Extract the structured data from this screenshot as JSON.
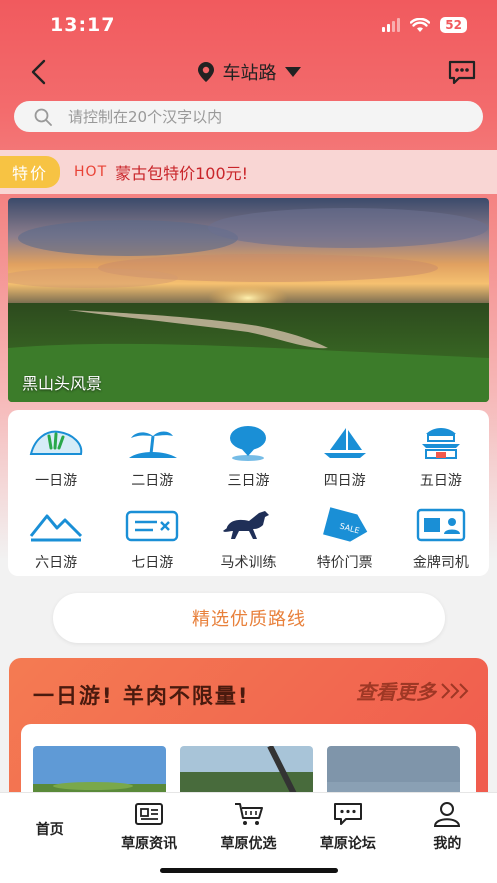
{
  "status_bar": {
    "time": "13:17",
    "battery": "52"
  },
  "nav": {
    "location": "车站路"
  },
  "search": {
    "placeholder": "请控制在20个汉字以内"
  },
  "promo": {
    "tag": "特价",
    "hot": "HOT",
    "text": "蒙古包特价100元!"
  },
  "banner": {
    "caption": "黑山头风景"
  },
  "categories": [
    {
      "label": "一日游",
      "icon": "grass-icon"
    },
    {
      "label": "二日游",
      "icon": "palm-island-icon"
    },
    {
      "label": "三日游",
      "icon": "map-pin-icon"
    },
    {
      "label": "四日游",
      "icon": "sailboat-icon"
    },
    {
      "label": "五日游",
      "icon": "pagoda-icon"
    },
    {
      "label": "六日游",
      "icon": "mountain-icon"
    },
    {
      "label": "七日游",
      "icon": "ticket-icon"
    },
    {
      "label": "马术训练",
      "icon": "horse-icon"
    },
    {
      "label": "特价门票",
      "icon": "sale-tag-icon"
    },
    {
      "label": "金牌司机",
      "icon": "driver-card-icon"
    }
  ],
  "section": {
    "title": "精选优质路线"
  },
  "deal": {
    "title": "一日游! 羊肉不限量!",
    "more": "查看更多"
  },
  "tabbar": [
    {
      "label": "首页",
      "icon": "home"
    },
    {
      "label": "草原资讯",
      "icon": "news-icon"
    },
    {
      "label": "草原优选",
      "icon": "cart-icon"
    },
    {
      "label": "草原论坛",
      "icon": "chat-icon"
    },
    {
      "label": "我的",
      "icon": "user-icon"
    }
  ],
  "colors": {
    "primary": "#f15a5e",
    "accent": "#1a8fd6",
    "section_text": "#e8813c"
  }
}
